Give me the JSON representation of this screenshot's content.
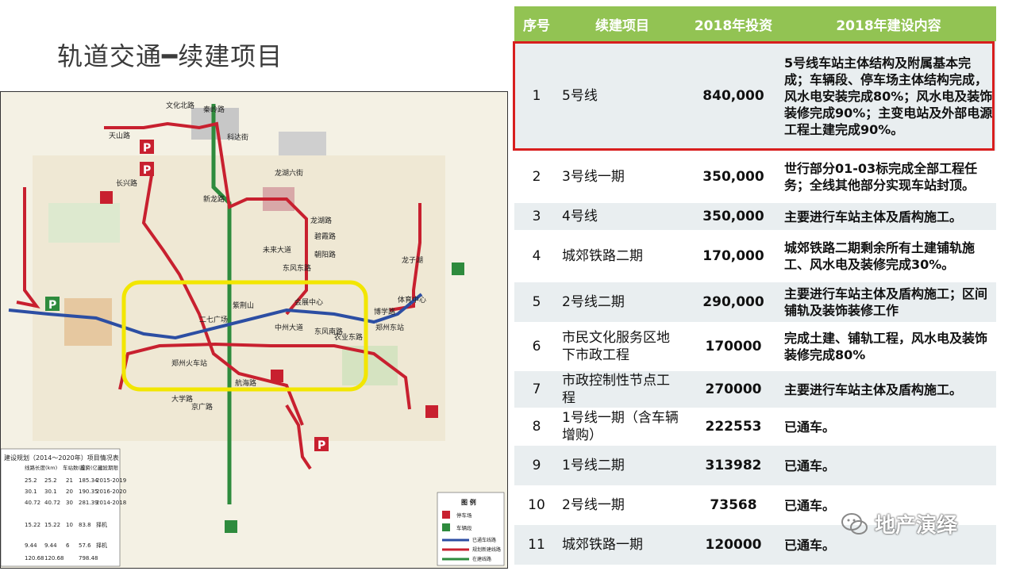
{
  "slide": {
    "title": "轨道交通━续建项目"
  },
  "table": {
    "headers": [
      "序号",
      "续建项目",
      "2018年投资",
      "2018年建设内容"
    ],
    "rows": [
      {
        "no": "1",
        "name": "5号线",
        "amount": "840,000",
        "content": "5号线车站主体结构及附属基本完成；车辆段、停车场主体结构完成，风水电安装完成80%；风水电及装饰装修完成90%；主变电站及外部电源工程土建完成90%。"
      },
      {
        "no": "2",
        "name": "3号线一期",
        "amount": "350,000",
        "content": "世行部分01-03标完成全部工程任务；全线其他部分实现车站封顶。"
      },
      {
        "no": "3",
        "name": "4号线",
        "amount": "350,000",
        "content": "主要进行车站主体及盾构施工。"
      },
      {
        "no": "4",
        "name": "城郊铁路二期",
        "amount": "170,000",
        "content": "城郊铁路二期剩余所有土建铺轨施工、风水电及装修完成30%。"
      },
      {
        "no": "5",
        "name": "2号线二期",
        "amount": "290,000",
        "content": "主要进行车站主体及盾构施工；区间铺轨及装饰装修工作"
      },
      {
        "no": "6",
        "name": "市民文化服务区地下市政工程",
        "amount": "170000",
        "content": "完成土建、铺轨工程，风水电及装饰装修完成80%"
      },
      {
        "no": "7",
        "name": "市政控制性节点工程",
        "amount": "270000",
        "content": "主要进行车站主体及盾构施工。"
      },
      {
        "no": "8",
        "name": "1号线一期（含车辆增购）",
        "amount": "222553",
        "content": "已通车。"
      },
      {
        "no": "9",
        "name": "1号线二期",
        "amount": "313982",
        "content": "已通车。"
      },
      {
        "no": "10",
        "name": "2号线一期",
        "amount": "73568",
        "content": "已通车。"
      },
      {
        "no": "11",
        "name": "城郊铁路一期",
        "amount": "120000",
        "content": "已通车。"
      }
    ]
  },
  "map": {
    "stations": [
      "天山路",
      "文化北路",
      "秦岭路",
      "科达街",
      "长兴路",
      "新龙路",
      "龙湖六街",
      "龙湖路",
      "碧霞路",
      "朝阳路",
      "东风东路",
      "未来大道",
      "会展中心",
      "东风南路",
      "中州大道",
      "农业东路",
      "博学路",
      "体育中心",
      "龙子湖",
      "郑州东站",
      "紫荆山",
      "二七广场",
      "郑州火车站",
      "航海路",
      "大学路",
      "京广路"
    ],
    "legend_title": "图 例",
    "legend_items": [
      "停车场",
      "车辆段",
      "已通车线路",
      "规划新建线路",
      "在建线路"
    ],
    "inset_title": "建设规划（2014～2020年）项目情况表",
    "inset_headers": [
      "线路长度(km)",
      "车站数(座)",
      "投资(亿元)",
      "建设期限"
    ],
    "inset_rows": [
      [
        "25.2",
        "25.2",
        "21",
        "185.34",
        "2015-2019"
      ],
      [
        "30.1",
        "30.1",
        "20",
        "190.35",
        "2016-2020"
      ],
      [
        "40.72",
        "40.72",
        "30",
        "281.39",
        "2014-2018"
      ],
      [
        "15.22",
        "15.22",
        "10",
        "83.8",
        "择机"
      ],
      [
        "9.44",
        "9.44",
        "6",
        "57.6",
        "择机"
      ],
      [
        "120.68",
        "120.68",
        "",
        "798.48",
        ""
      ]
    ]
  },
  "watermark": {
    "text": "地产演绎",
    "icon": "wechat-icon"
  },
  "colors": {
    "header_green": "#92c353",
    "highlight_red": "#d81e1e",
    "line_red": "#c8202f",
    "line_blue": "#2c4ea3",
    "line_green": "#2e8b3d",
    "loop_yellow": "#f2e600"
  }
}
